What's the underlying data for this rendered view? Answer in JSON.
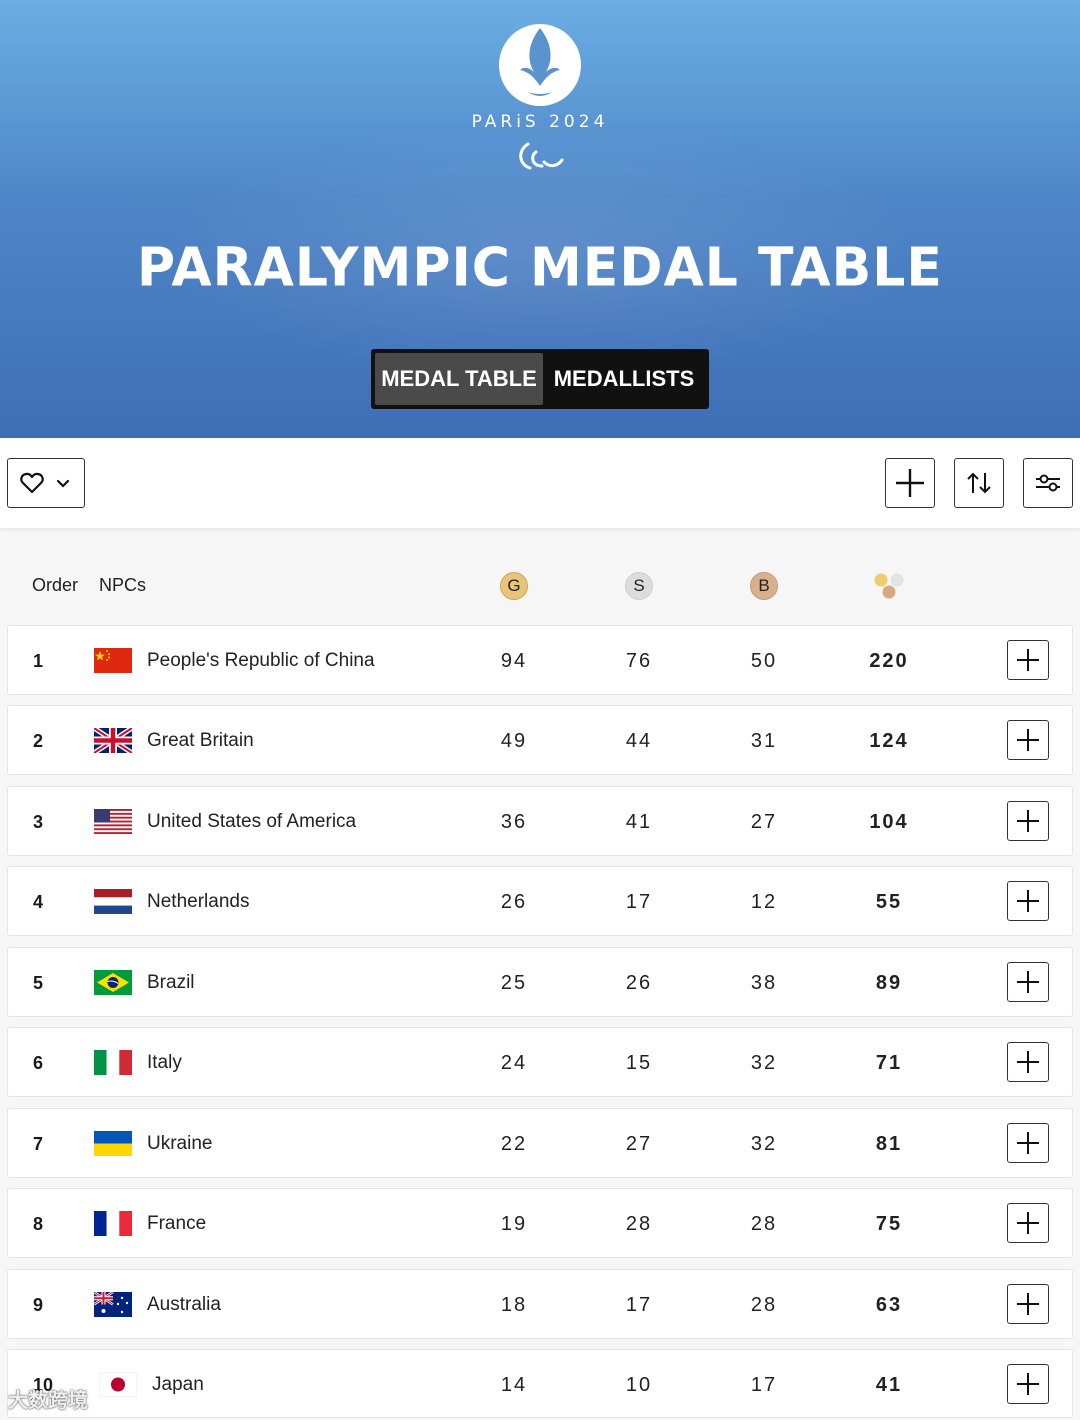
{
  "header": {
    "brand": "PARiS 2024",
    "title": "PARALYMPIC MEDAL TABLE",
    "tabs": [
      {
        "label": "MEDAL TABLE",
        "active": true
      },
      {
        "label": "MEDALLISTS",
        "active": false
      }
    ]
  },
  "toolbar": {
    "favorites_icon": "heart-icon",
    "actions": [
      "plus-icon",
      "sort-icon",
      "filter-icon"
    ]
  },
  "table": {
    "headers": {
      "order": "Order",
      "npcs": "NPCs",
      "gold": "G",
      "silver": "S",
      "bronze": "B"
    },
    "rows": [
      {
        "rank": "1",
        "country": "People's Republic of China",
        "gold": "94",
        "silver": "76",
        "bronze": "50",
        "total": "220"
      },
      {
        "rank": "2",
        "country": "Great Britain",
        "gold": "49",
        "silver": "44",
        "bronze": "31",
        "total": "124"
      },
      {
        "rank": "3",
        "country": "United States of America",
        "gold": "36",
        "silver": "41",
        "bronze": "27",
        "total": "104"
      },
      {
        "rank": "4",
        "country": "Netherlands",
        "gold": "26",
        "silver": "17",
        "bronze": "12",
        "total": "55"
      },
      {
        "rank": "5",
        "country": "Brazil",
        "gold": "25",
        "silver": "26",
        "bronze": "38",
        "total": "89"
      },
      {
        "rank": "6",
        "country": "Italy",
        "gold": "24",
        "silver": "15",
        "bronze": "32",
        "total": "71"
      },
      {
        "rank": "7",
        "country": "Ukraine",
        "gold": "22",
        "silver": "27",
        "bronze": "32",
        "total": "81"
      },
      {
        "rank": "8",
        "country": "France",
        "gold": "19",
        "silver": "28",
        "bronze": "28",
        "total": "75"
      },
      {
        "rank": "9",
        "country": "Australia",
        "gold": "18",
        "silver": "17",
        "bronze": "28",
        "total": "63"
      },
      {
        "rank": "10",
        "country": "Japan",
        "gold": "14",
        "silver": "10",
        "bronze": "17",
        "total": "41"
      }
    ]
  },
  "colors": {
    "hero_top": "#6aaee3",
    "hero_bottom": "#3f6eb5",
    "gold": "#e8c47a",
    "silver": "#dcdcdc",
    "bronze": "#d9b08c"
  },
  "watermark": "大数跨境"
}
